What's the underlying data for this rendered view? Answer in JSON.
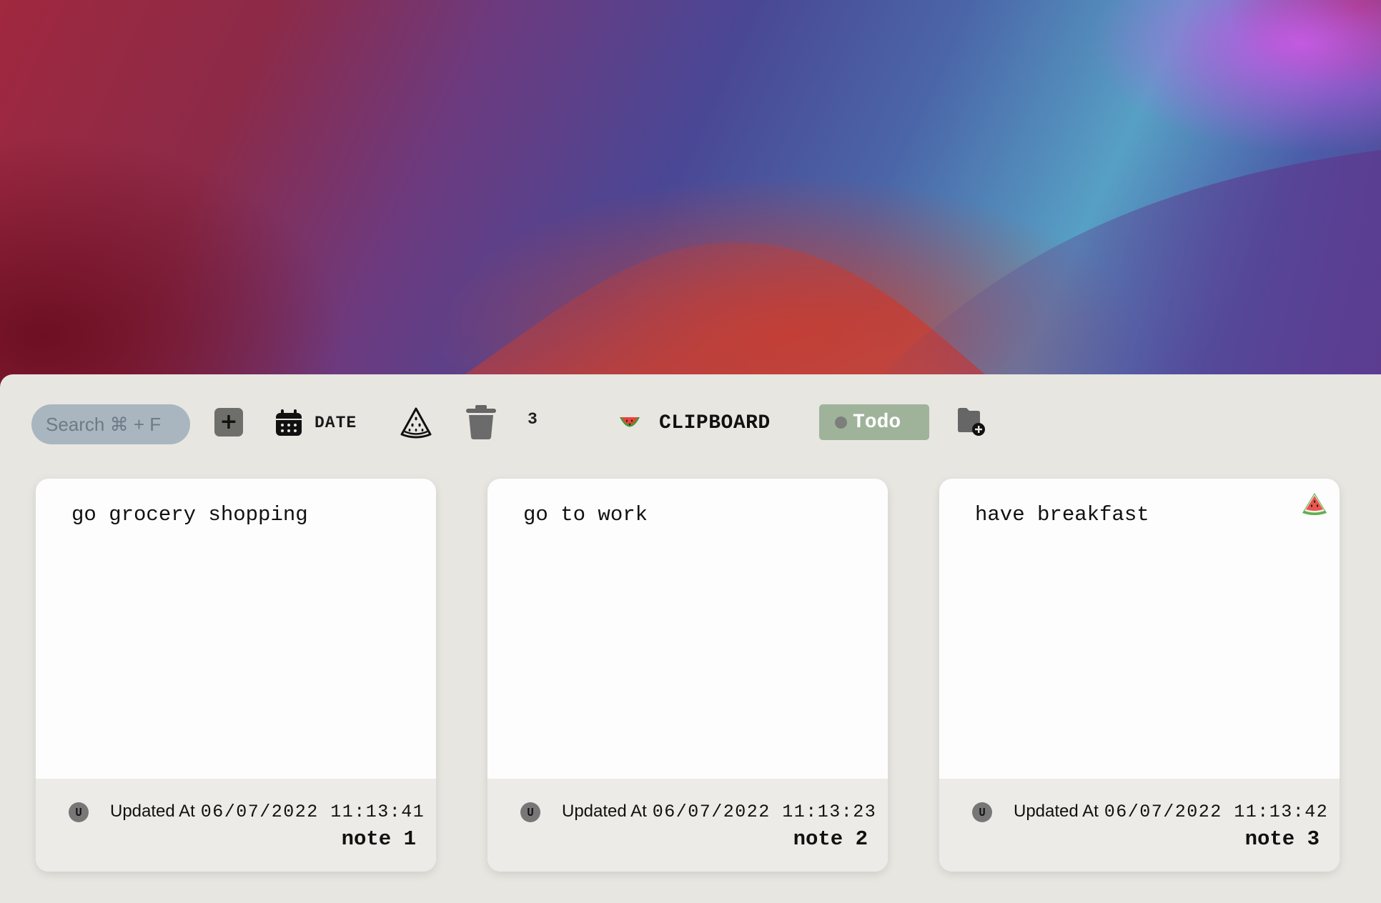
{
  "toolbar": {
    "search_placeholder": "Search ⌘ + F",
    "add_label": "+",
    "date_label": "DATE",
    "note_count": "3",
    "clipboard_label": "CLIPBOARD",
    "clipboard_icon": "watermelon-slice",
    "todo_label": "Todo",
    "todo_colors": {
      "background": "#9fb39a",
      "dot": "#7d7f7c"
    },
    "search_color": "#a9b6bf"
  },
  "notes": [
    {
      "text": "go grocery shopping",
      "avatar": "U",
      "updated_prefix": "Updated At",
      "updated_time": "06/07/2022 11:13:41",
      "name": "note 1",
      "has_melon": false
    },
    {
      "text": "go to work",
      "avatar": "U",
      "updated_prefix": "Updated At",
      "updated_time": "06/07/2022 11:13:23",
      "name": "note 2",
      "has_melon": false
    },
    {
      "text": "have breakfast",
      "avatar": "U",
      "updated_prefix": "Updated At",
      "updated_time": "06/07/2022 11:13:42",
      "name": "note 3",
      "has_melon": true
    }
  ],
  "colors": {
    "panel": "#e7e6e1",
    "card": "#fdfdfd",
    "card_footer": "#ecebe7"
  }
}
